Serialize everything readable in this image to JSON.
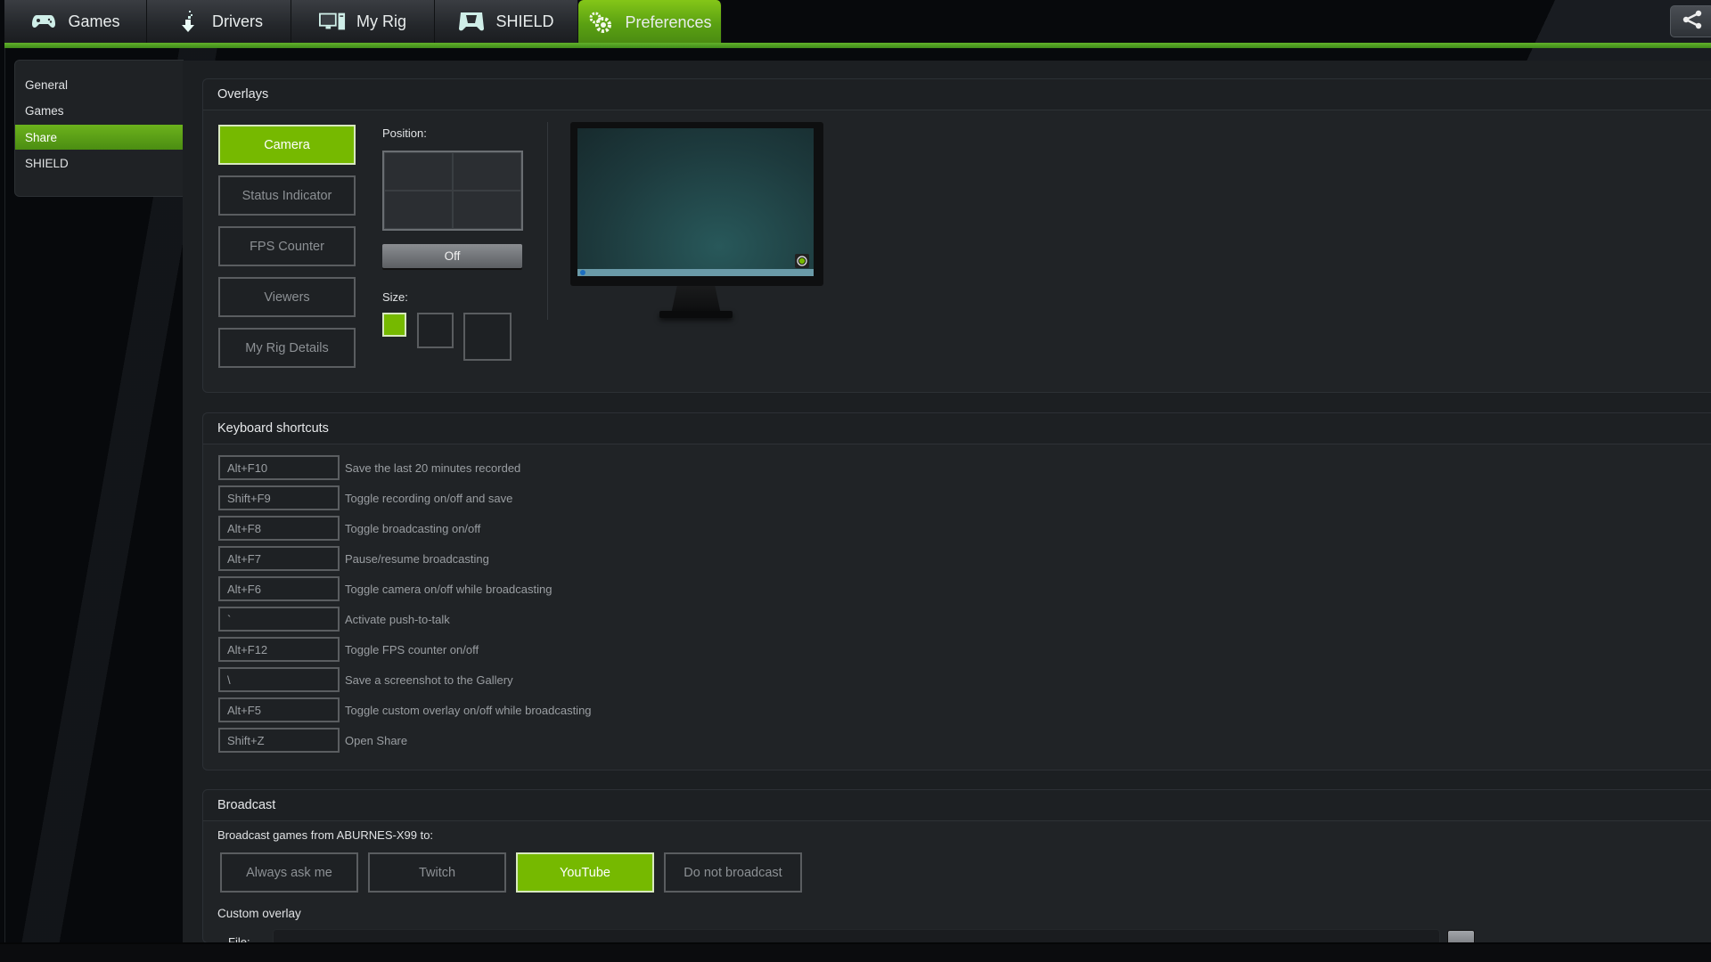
{
  "topnav": {
    "tabs": [
      {
        "label": "Games",
        "icon": "gamepad-icon",
        "active": false
      },
      {
        "label": "Drivers",
        "icon": "download-arrow-icon",
        "active": false
      },
      {
        "label": "My Rig",
        "icon": "computer-icon",
        "active": false
      },
      {
        "label": "SHIELD",
        "icon": "shield-controller-icon",
        "active": false
      },
      {
        "label": "Preferences",
        "icon": "gears-icon",
        "active": true
      }
    ],
    "share_icon": "share-icon"
  },
  "sidebar": {
    "items": [
      {
        "label": "General",
        "active": false
      },
      {
        "label": "Games",
        "active": false
      },
      {
        "label": "Share",
        "active": true
      },
      {
        "label": "SHIELD",
        "active": false
      }
    ]
  },
  "overlays": {
    "title": "Overlays",
    "buttons": [
      {
        "label": "Camera",
        "active": true
      },
      {
        "label": "Status Indicator",
        "active": false
      },
      {
        "label": "FPS Counter",
        "active": false
      },
      {
        "label": "Viewers",
        "active": false
      },
      {
        "label": "My Rig Details",
        "active": false
      }
    ],
    "position_label": "Position:",
    "position_toggle": "Off",
    "size_label": "Size:",
    "sizes": [
      "small",
      "medium",
      "large"
    ],
    "selected_size": "small",
    "accent_color": "#76b900"
  },
  "shortcuts": {
    "title": "Keyboard shortcuts",
    "rows": [
      {
        "key": "Alt+F10",
        "desc": "Save the last 20 minutes recorded"
      },
      {
        "key": "Shift+F9",
        "desc": "Toggle recording on/off and save"
      },
      {
        "key": "Alt+F8",
        "desc": "Toggle broadcasting on/off"
      },
      {
        "key": "Alt+F7",
        "desc": "Pause/resume broadcasting"
      },
      {
        "key": "Alt+F6",
        "desc": "Toggle camera on/off while broadcasting"
      },
      {
        "key": "`",
        "desc": "Activate push-to-talk"
      },
      {
        "key": "Alt+F12",
        "desc": "Toggle FPS counter on/off"
      },
      {
        "key": "\\",
        "desc": "Save a screenshot to the Gallery"
      },
      {
        "key": "Alt+F5",
        "desc": "Toggle custom overlay on/off while broadcasting"
      },
      {
        "key": "Shift+Z",
        "desc": "Open Share"
      }
    ]
  },
  "broadcast": {
    "title": "Broadcast",
    "target_label": "Broadcast games from ABURNES-X99 to:",
    "options": [
      {
        "label": "Always ask me",
        "active": false
      },
      {
        "label": "Twitch",
        "active": false
      },
      {
        "label": "YouTube",
        "active": true
      },
      {
        "label": "Do not broadcast",
        "active": false
      }
    ],
    "custom_overlay_label": "Custom overlay",
    "file_label": "File:",
    "file_value": ""
  }
}
